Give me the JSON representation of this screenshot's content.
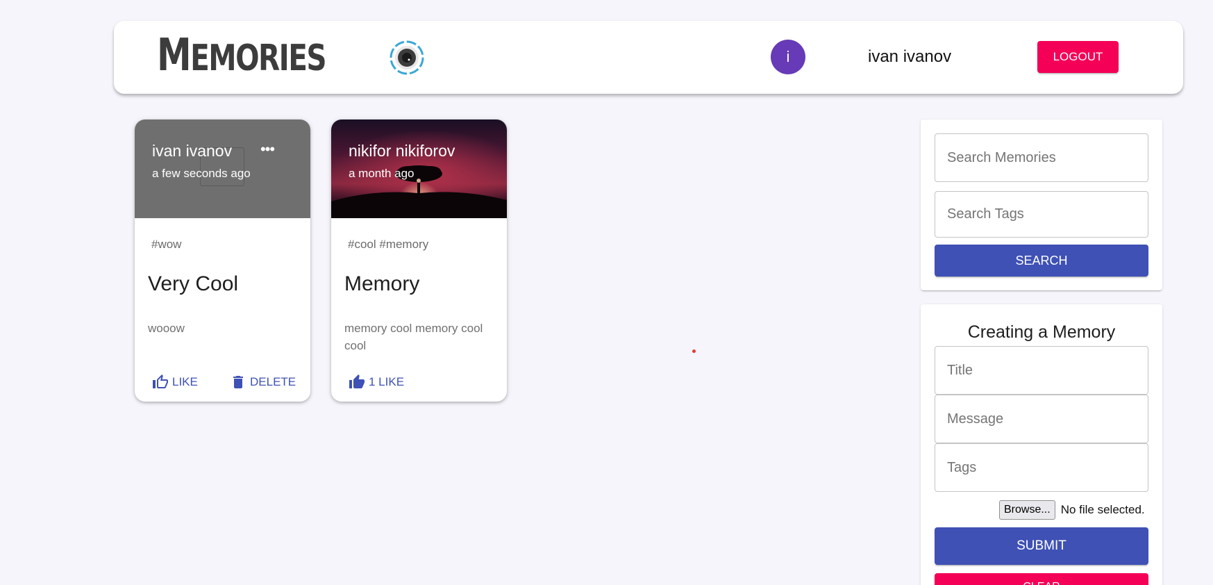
{
  "header": {
    "brand": "Memories",
    "brand_lens_icon": "camera-lens-icon",
    "avatar_initial": "i",
    "username": "ivan ivanov",
    "logout_label": "LOGOUT",
    "colors": {
      "avatar": "#673ab7",
      "logout": "#f50057"
    }
  },
  "posts": [
    {
      "creator": "ivan ivanov",
      "time": "a few seconds ago",
      "tags": "#wow",
      "title": "Very Cool",
      "message": "wooow",
      "like_label": "LIKE",
      "delete_label": "DELETE",
      "has_menu": true
    },
    {
      "creator": "nikifor nikiforov",
      "time": "a month ago",
      "tags": "#cool #memory",
      "title": "Memory",
      "message": "memory cool memory cool cool",
      "like_label": "1 LIKE"
    }
  ],
  "search": {
    "memories_placeholder": "Search Memories",
    "tags_placeholder": "Search Tags",
    "button_label": "SEARCH"
  },
  "form": {
    "heading": "Creating a Memory",
    "title_placeholder": "Title",
    "message_placeholder": "Message",
    "tags_placeholder": "Tags",
    "browse_label": "Browse...",
    "file_status": "No file selected.",
    "submit_label": "SUBMIT",
    "clear_label": "CLEAR"
  },
  "colors": {
    "primary": "#3f51b5",
    "secondary": "#f50057",
    "background": "#f5f5fb"
  }
}
